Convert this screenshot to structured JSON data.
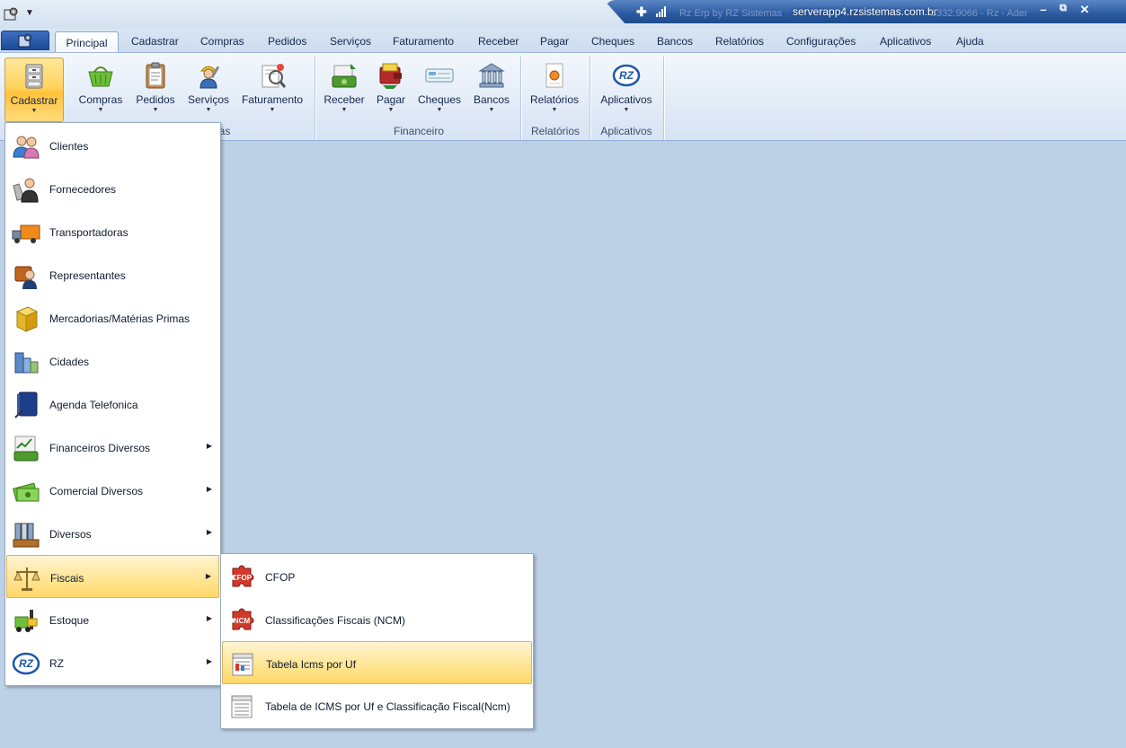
{
  "titlebar": {
    "ghost_left": "Rz Erp by RZ Sistemas",
    "server": "serverapp4.rzsistemas.com.br",
    "ghost_right": "3332.9066 - Rz - Ader",
    "flag_glyph": "✚",
    "minimize": "–",
    "restore": "⧉",
    "close": "✕"
  },
  "tabs": [
    {
      "label": "Principal",
      "active": true
    },
    {
      "label": "Cadastrar"
    },
    {
      "label": "Compras"
    },
    {
      "label": "Pedidos"
    },
    {
      "label": "Serviços"
    },
    {
      "label": "Faturamento"
    },
    {
      "label": "Receber"
    },
    {
      "label": "Pagar"
    },
    {
      "label": "Cheques"
    },
    {
      "label": "Bancos"
    },
    {
      "label": "Relatórios"
    },
    {
      "label": "Configurações"
    },
    {
      "label": "Aplicativos"
    },
    {
      "label": "Ajuda"
    }
  ],
  "ribbon": {
    "buttons": [
      {
        "label": "Cadastrar",
        "icon": "cabinet-icon"
      },
      {
        "label": "Compras",
        "icon": "basket-icon"
      },
      {
        "label": "Pedidos",
        "icon": "clipboard-icon"
      },
      {
        "label": "Serviços",
        "icon": "worker-icon"
      },
      {
        "label": "Faturamento",
        "icon": "invoice-icon"
      },
      {
        "label": "Receber",
        "icon": "money-in-icon"
      },
      {
        "label": "Pagar",
        "icon": "wallet-icon"
      },
      {
        "label": "Cheques",
        "icon": "cheque-icon"
      },
      {
        "label": "Bancos",
        "icon": "bank-icon"
      },
      {
        "label": "Relatórios",
        "icon": "report-icon"
      },
      {
        "label": "Aplicativos",
        "icon": "rz-logo-icon"
      }
    ],
    "groups": {
      "vendas_fragment": "as",
      "financeiro": "Financeiro",
      "relatorios": "Relatórios",
      "aplicativos": "Aplicativos"
    },
    "dropdown_glyph": "▼"
  },
  "menu": {
    "arrow_glyph": "▶",
    "items": [
      {
        "label": "Clientes",
        "icon": "people-icon"
      },
      {
        "label": "Fornecedores",
        "icon": "supplier-icon"
      },
      {
        "label": "Transportadoras",
        "icon": "truck-icon"
      },
      {
        "label": "Representantes",
        "icon": "representative-icon"
      },
      {
        "label": "Mercadorias/Matérias Primas",
        "icon": "box-icon"
      },
      {
        "label": "Cidades",
        "icon": "city-icon"
      },
      {
        "label": "Agenda Telefonica",
        "icon": "phonebook-icon"
      },
      {
        "label": "Financeiros Diversos",
        "icon": "finance-icon",
        "submenu": true
      },
      {
        "label": "Comercial Diversos",
        "icon": "cash-icon",
        "submenu": true
      },
      {
        "label": "Diversos",
        "icon": "files-icon",
        "submenu": true
      },
      {
        "label": "Fiscais",
        "icon": "scales-icon",
        "submenu": true,
        "highlighted": true
      },
      {
        "label": "Estoque",
        "icon": "forklift-icon",
        "submenu": true
      },
      {
        "label": "RZ",
        "icon": "rz-logo-icon",
        "submenu": true
      }
    ]
  },
  "submenu": {
    "items": [
      {
        "label": "CFOP",
        "icon": "cfop-puzzle-icon",
        "badge": "CFOP"
      },
      {
        "label": "Classificações Fiscais (NCM)",
        "icon": "ncm-puzzle-icon",
        "badge": "NCM"
      },
      {
        "label": "Tabela Icms por Uf",
        "icon": "table-calendar-icon",
        "highlighted": true
      },
      {
        "label": "Tabela de ICMS por Uf e Classificação Fiscal(Ncm)",
        "icon": "table-calendar-icon"
      }
    ]
  },
  "rz_logo_text": "RZ",
  "colors": {
    "accent": "#2a5aa0",
    "highlight": "#ffd768",
    "background": "#bcd0e6"
  }
}
